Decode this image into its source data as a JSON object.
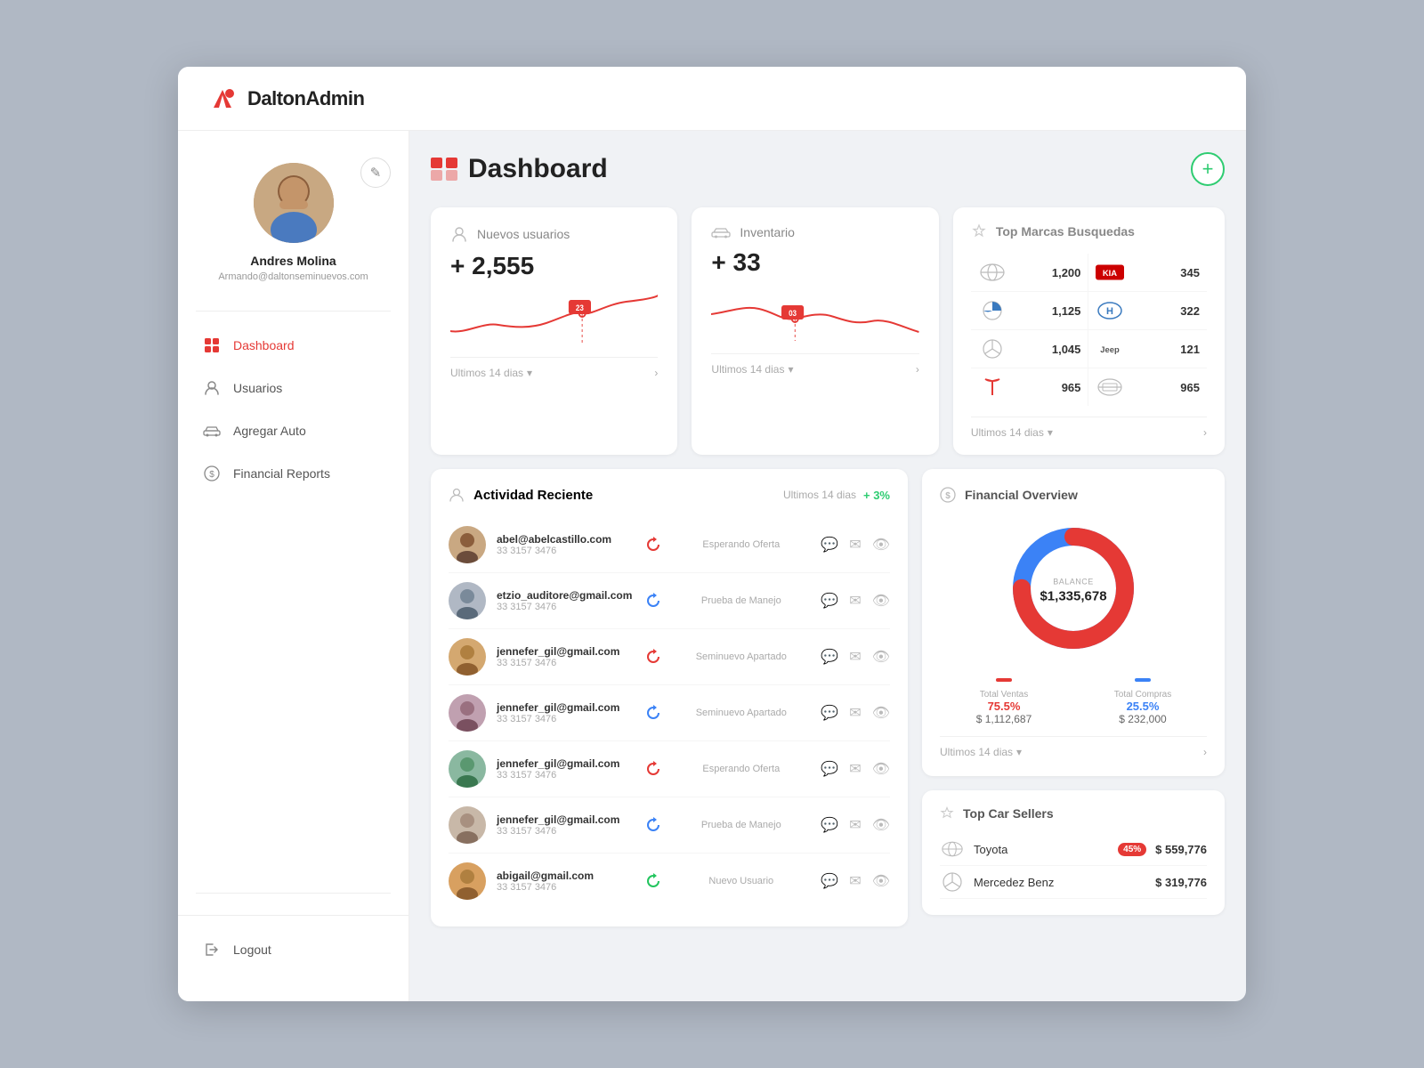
{
  "app": {
    "name": "DaltonAdmin",
    "logo_letter": "D"
  },
  "sidebar": {
    "edit_label": "✎",
    "profile": {
      "name": "Andres Molina",
      "email": "Armando@daltonseminuevos.com"
    },
    "nav": [
      {
        "id": "dashboard",
        "label": "Dashboard",
        "icon": "grid",
        "active": true
      },
      {
        "id": "usuarios",
        "label": "Usuarios",
        "icon": "user",
        "active": false
      },
      {
        "id": "agregar-auto",
        "label": "Agregar Auto",
        "icon": "car",
        "active": false
      },
      {
        "id": "financial-reports",
        "label": "Financial Reports",
        "icon": "dollar",
        "active": false
      }
    ],
    "logout_label": "Logout"
  },
  "header": {
    "title": "Dashboard",
    "add_btn_label": "+"
  },
  "stats": [
    {
      "id": "nuevos-usuarios",
      "icon": "user",
      "label": "Nuevos usuarios",
      "value": "+ 2,555",
      "period": "Ultimos 14 dias",
      "chart_point": "23"
    },
    {
      "id": "inventario",
      "icon": "car",
      "label": "Inventario",
      "value": "+ 33",
      "period": "Ultimos 14 dias",
      "chart_point": "03"
    }
  ],
  "top_marcas": {
    "title": "Top Marcas Busquedas",
    "period": "Ultimos 14 dias",
    "items": [
      {
        "brand": "Toyota",
        "count": "1,200",
        "side": "left"
      },
      {
        "brand": "KIA",
        "count": "345",
        "side": "right"
      },
      {
        "brand": "BMW",
        "count": "1,125",
        "side": "left"
      },
      {
        "brand": "Hyundai",
        "count": "322",
        "side": "right"
      },
      {
        "brand": "Mercedes",
        "count": "1,045",
        "side": "left"
      },
      {
        "brand": "Jeep",
        "count": "121",
        "side": "right"
      },
      {
        "brand": "Tesla",
        "count": "965",
        "side": "left"
      },
      {
        "brand": "Nissan",
        "count": "965",
        "side": "right"
      }
    ]
  },
  "activity": {
    "title": "Actividad Reciente",
    "period": "Ultimos 14 dias",
    "growth": "+ 3%",
    "items": [
      {
        "email": "abel@abelcastillo.com",
        "phone": "33 3157 3476",
        "status": "Esperando Oferta",
        "color": "red"
      },
      {
        "email": "etzio_auditore@gmail.com",
        "phone": "33 3157 3476",
        "status": "Prueba de Manejo",
        "color": "blue"
      },
      {
        "email": "jennefer_gil@gmail.com",
        "phone": "33 3157 3476",
        "status": "Seminuevo Apartado",
        "color": "red"
      },
      {
        "email": "jennefer_gil@gmail.com",
        "phone": "33 3157 3476",
        "status": "Seminuevo Apartado",
        "color": "blue"
      },
      {
        "email": "jennefer_gil@gmail.com",
        "phone": "33 3157 3476",
        "status": "Esperando Oferta",
        "color": "red"
      },
      {
        "email": "jennefer_gil@gmail.com",
        "phone": "33 3157 3476",
        "status": "Prueba de Manejo",
        "color": "blue"
      },
      {
        "email": "abigail@gmail.com",
        "phone": "33 3157 3476",
        "status": "Nuevo Usuario",
        "color": "green"
      }
    ]
  },
  "financial": {
    "title": "Financial Overview",
    "period": "Ultimos 14 dias",
    "balance_label": "BALANCE",
    "balance_value": "$1,335,678",
    "total_ventas_label": "Total Ventas",
    "total_ventas_pct": "75.5%",
    "total_ventas_amount": "$ 1,112,687",
    "total_compras_label": "Total Compras",
    "total_compras_pct": "25.5%",
    "total_compras_amount": "$ 232,000",
    "ventas_color": "#e53935",
    "compras_color": "#3b82f6"
  },
  "top_sellers": {
    "title": "Top Car Sellers",
    "items": [
      {
        "brand": "Toyota",
        "amount": "$ 559,776",
        "badge": "45%"
      },
      {
        "brand": "Mercedez Benz",
        "amount": "$ 319,776",
        "badge": ""
      }
    ]
  }
}
